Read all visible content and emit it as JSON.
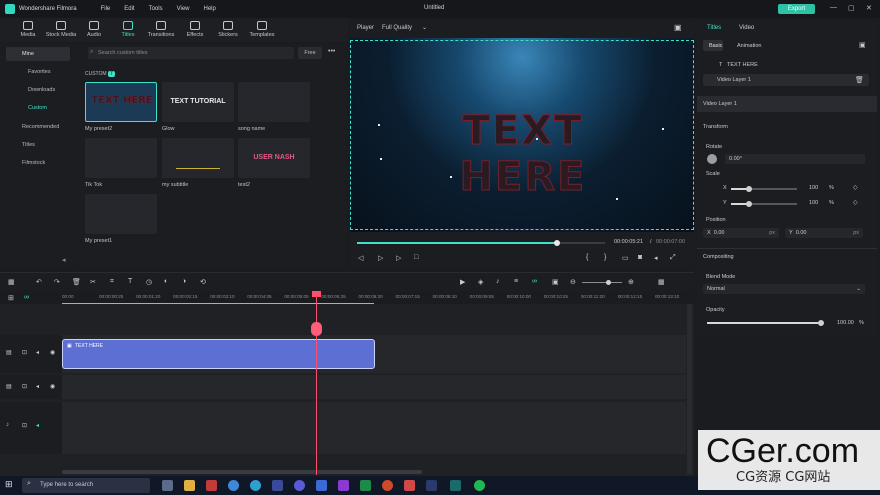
{
  "app": {
    "name": "Wondershare Filmora",
    "doc_title": "Untitled",
    "export_label": "Export"
  },
  "menu": [
    "File",
    "Edit",
    "Tools",
    "View",
    "Help"
  ],
  "toolbar": [
    {
      "label": "Media",
      "icon": "media-icon"
    },
    {
      "label": "Stock Media",
      "icon": "stock-media-icon"
    },
    {
      "label": "Audio",
      "icon": "audio-icon"
    },
    {
      "label": "Titles",
      "icon": "titles-icon",
      "active": true
    },
    {
      "label": "Transitions",
      "icon": "transitions-icon"
    },
    {
      "label": "Effects",
      "icon": "effects-icon"
    },
    {
      "label": "Stickers",
      "icon": "stickers-icon"
    },
    {
      "label": "Templates",
      "icon": "templates-icon"
    }
  ],
  "leftnav": {
    "items": [
      {
        "label": "Mine",
        "selected": true
      },
      {
        "label": "Favorites",
        "child": true
      },
      {
        "label": "Downloads",
        "child": true
      },
      {
        "label": "Custom",
        "child": true,
        "active": true
      },
      {
        "label": "Recommended"
      },
      {
        "label": "Titles"
      },
      {
        "label": "Filmstock"
      }
    ]
  },
  "library": {
    "search_placeholder": "Search custom titles",
    "filter": "Free",
    "section": "CUSTOM",
    "section_count": "7",
    "thumbs": [
      {
        "label": "My preset2",
        "text": "TEXT HERE",
        "selected": true
      },
      {
        "label": "Glow",
        "text": "TEXT TUTORIAL"
      },
      {
        "label": "song name",
        "text": ""
      },
      {
        "label": "Tik Tok",
        "text": ""
      },
      {
        "label": "my subtitle",
        "text": ""
      },
      {
        "label": "test2",
        "text": "USER NASH"
      },
      {
        "label": "My preset1",
        "text": ""
      }
    ]
  },
  "player": {
    "label": "Player",
    "quality": "Full Quality",
    "overlay_text": "TEXT HERE",
    "current_time": "00:00:05:21",
    "total_time": "00:00:07:00",
    "progress": 0.8
  },
  "rightpanel": {
    "tabs": [
      "Titles",
      "Video"
    ],
    "subtabs": [
      "Basic",
      "Animation"
    ],
    "layers": [
      "TEXT HERE",
      "Video Layer 1"
    ],
    "section_title": "Video Layer 1",
    "transform": "Transform",
    "rotate_label": "Rotate",
    "rotate_value": "0.00°",
    "scale_label": "Scale",
    "x_label": "X",
    "y_label": "Y",
    "scale_x": "100",
    "scale_y": "100",
    "pct": "%",
    "position_label": "Position",
    "pos_x": "0.00",
    "pos_y": "0.00",
    "px": "px",
    "compositing": "Compositing",
    "blend_label": "Blend Mode",
    "blend_value": "Normal",
    "opacity_label": "Opacity",
    "opacity_value": "100.00"
  },
  "timeline": {
    "ruler": [
      "00:00",
      "00:00:00:25",
      "00:00:01:20",
      "00:00:02:15",
      "00:00:03:10",
      "00:00:04:05",
      "00:00:05:00",
      "00:00:05:25",
      "00:00:06:20",
      "00:00:07:15",
      "00:00:08:10",
      "00:00:09:05",
      "00:00:10:00",
      "00:00:10:25",
      "00:00:11:20",
      "00:00:12:15",
      "00:00:13:10"
    ],
    "clip_label": "TEXT HERE"
  },
  "taskbar": {
    "search": "Type here to search"
  },
  "watermark": {
    "line1": "CGer.com",
    "line2": "CG资源 CG网站"
  },
  "colors": {
    "accent": "#3fe1cb",
    "clip": "#5e6fd3",
    "playhead": "#ff4d6d",
    "export": "#2ec1a6"
  }
}
